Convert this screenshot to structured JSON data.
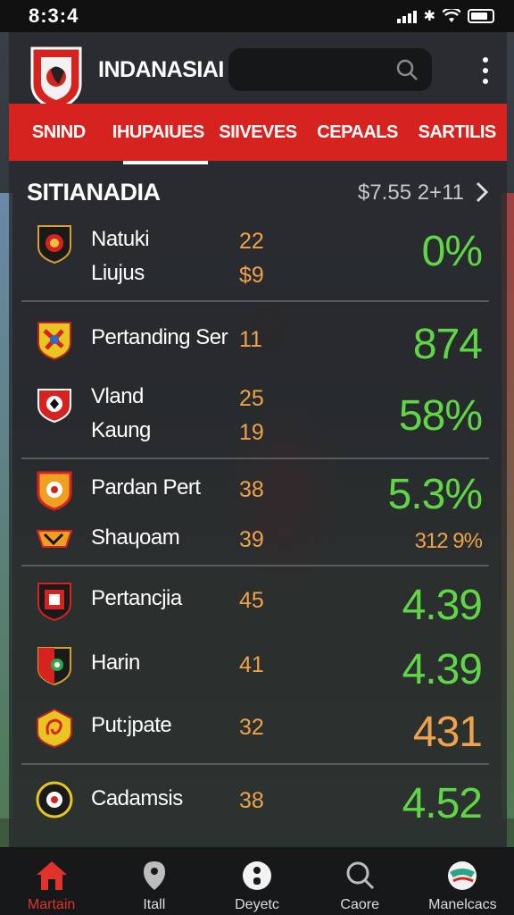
{
  "status_bar": {
    "time": "8:3:4"
  },
  "header": {
    "title": "INDANASIAI",
    "search_placeholder": ""
  },
  "tabs": [
    {
      "label": "SNIND",
      "active": false
    },
    {
      "label": "IHUPAIUES",
      "active": true
    },
    {
      "label": "SIIVEVES",
      "active": false
    },
    {
      "label": "CEPAALS",
      "active": false
    },
    {
      "label": "SARTILIS",
      "active": false
    }
  ],
  "section": {
    "title": "SITIANADIA",
    "meta": "$7.55 2+11"
  },
  "rows": [
    {
      "team": "Natuki",
      "num": "22",
      "big": "0%",
      "crest": "crest-black-red"
    },
    {
      "team": "Liujus",
      "num": "$9"
    },
    {
      "team": "Pertanding Ser",
      "num": "11",
      "big": "874",
      "crest": "crest-yellow-red"
    },
    {
      "team": "Vland",
      "num": "25",
      "big": "58%",
      "crest": "crest-red-white"
    },
    {
      "team": "Kaung",
      "num": "19"
    },
    {
      "team": "Pardan Pert",
      "num": "38",
      "big": "5.3%",
      "crest": "crest-red-yellow"
    },
    {
      "team": "Shaɥoam",
      "num": "39",
      "big": "312 9%",
      "crest": "crest-black-orange"
    },
    {
      "team": "Pertancjia",
      "num": "45",
      "big": "4.39",
      "crest": "crest-black-red-white"
    },
    {
      "team": "Harin",
      "num": "41",
      "big": "4.39",
      "crest": "crest-green-black"
    },
    {
      "team": "Put:jpate",
      "num": "32",
      "big": "431",
      "crest": "crest-yellow-red-swirl"
    },
    {
      "team": "Cadamsis",
      "num": "38",
      "big": "4.52",
      "crest": "crest-black-yellow"
    }
  ],
  "bottom_nav": [
    {
      "label": "Martain",
      "icon": "home-icon",
      "active": true
    },
    {
      "label": "Itall",
      "icon": "location-pin-icon",
      "active": false
    },
    {
      "label": "Deyetc",
      "icon": "ball-icon",
      "active": false
    },
    {
      "label": "Caore",
      "icon": "search-icon",
      "active": false
    },
    {
      "label": "Manelcacs",
      "icon": "globe-icon",
      "active": false
    }
  ],
  "colors": {
    "accent_red": "#d7231f",
    "value_green": "#5fd646",
    "value_orange": "#f0a24a"
  }
}
